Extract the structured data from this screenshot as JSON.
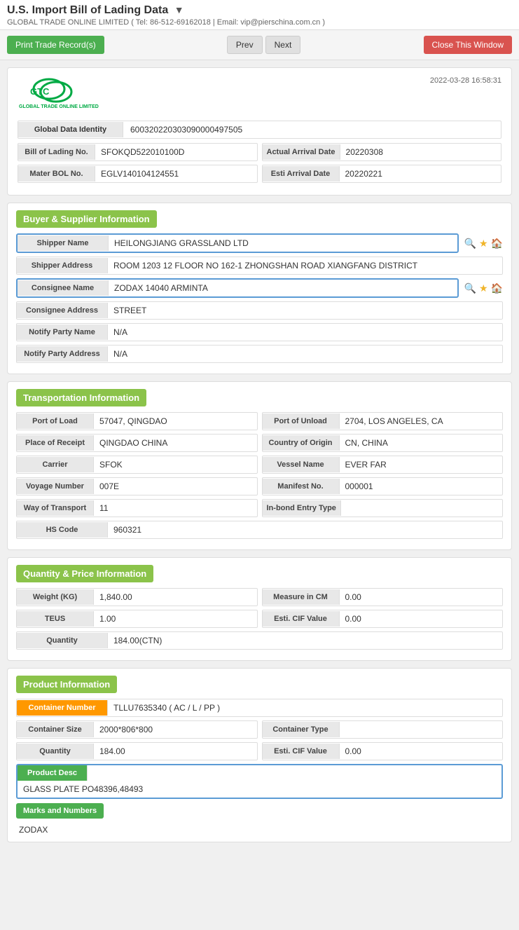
{
  "page": {
    "title": "U.S. Import Bill of Lading Data",
    "subtitle": "GLOBAL TRADE ONLINE LIMITED ( Tel: 86-512-69162018 | Email: vip@pierschina.com.cn )"
  },
  "toolbar": {
    "print_label": "Print Trade Record(s)",
    "prev_label": "Prev",
    "next_label": "Next",
    "close_label": "Close This Window"
  },
  "record": {
    "timestamp": "2022-03-28 16:58:31",
    "global_data_identity": "600320220303090000497505",
    "bill_of_lading_no": "SFOKQD522010100D",
    "actual_arrival_date_label": "Actual Arrival Date",
    "actual_arrival_date": "20220308",
    "mater_bol_no": "EGLV140104124551",
    "esti_arrival_date_label": "Esti Arrival Date",
    "esti_arrival_date": "20220221"
  },
  "buyer_supplier": {
    "section_title": "Buyer & Supplier Information",
    "shipper_name_label": "Shipper Name",
    "shipper_name": "HEILONGJIANG GRASSLAND LTD",
    "shipper_address_label": "Shipper Address",
    "shipper_address": "ROOM 1203 12 FLOOR NO 162-1 ZHONGSHAN ROAD XIANGFANG DISTRICT",
    "consignee_name_label": "Consignee Name",
    "consignee_name": "ZODAX 14040 ARMINTA",
    "consignee_address_label": "Consignee Address",
    "consignee_address": "STREET",
    "notify_party_name_label": "Notify Party Name",
    "notify_party_name": "N/A",
    "notify_party_address_label": "Notify Party Address",
    "notify_party_address": "N/A"
  },
  "transportation": {
    "section_title": "Transportation Information",
    "port_of_load_label": "Port of Load",
    "port_of_load": "57047, QINGDAO",
    "port_of_unload_label": "Port of Unload",
    "port_of_unload": "2704, LOS ANGELES, CA",
    "place_of_receipt_label": "Place of Receipt",
    "place_of_receipt": "QINGDAO CHINA",
    "country_of_origin_label": "Country of Origin",
    "country_of_origin": "CN, CHINA",
    "carrier_label": "Carrier",
    "carrier": "SFOK",
    "vessel_name_label": "Vessel Name",
    "vessel_name": "EVER FAR",
    "voyage_number_label": "Voyage Number",
    "voyage_number": "007E",
    "manifest_no_label": "Manifest No.",
    "manifest_no": "000001",
    "way_of_transport_label": "Way of Transport",
    "way_of_transport": "11",
    "in_bond_entry_type_label": "In-bond Entry Type",
    "in_bond_entry_type": "",
    "hs_code_label": "HS Code",
    "hs_code": "960321"
  },
  "quantity_price": {
    "section_title": "Quantity & Price Information",
    "weight_label": "Weight (KG)",
    "weight": "1,840.00",
    "measure_in_cm_label": "Measure in CM",
    "measure_in_cm": "0.00",
    "teus_label": "TEUS",
    "teus": "1.00",
    "esti_cif_value_label": "Esti. CIF Value",
    "esti_cif_value": "0.00",
    "quantity_label": "Quantity",
    "quantity": "184.00(CTN)"
  },
  "product": {
    "section_title": "Product Information",
    "container_number_label": "Container Number",
    "container_number": "TLLU7635340 ( AC / L / PP )",
    "container_size_label": "Container Size",
    "container_size": "2000*806*800",
    "container_type_label": "Container Type",
    "container_type": "",
    "quantity_label": "Quantity",
    "quantity": "184.00",
    "esti_cif_value_label": "Esti. CIF Value",
    "esti_cif_value": "0.00",
    "product_desc_label": "Product Desc",
    "product_desc": "GLASS PLATE PO48396,48493",
    "marks_and_numbers_label": "Marks and Numbers",
    "marks_and_numbers": "ZODAX"
  },
  "labels": {
    "global_data_identity": "Global Data Identity",
    "bill_of_lading_no": "Bill of Lading No.",
    "mater_bol_no": "Mater BOL No."
  }
}
